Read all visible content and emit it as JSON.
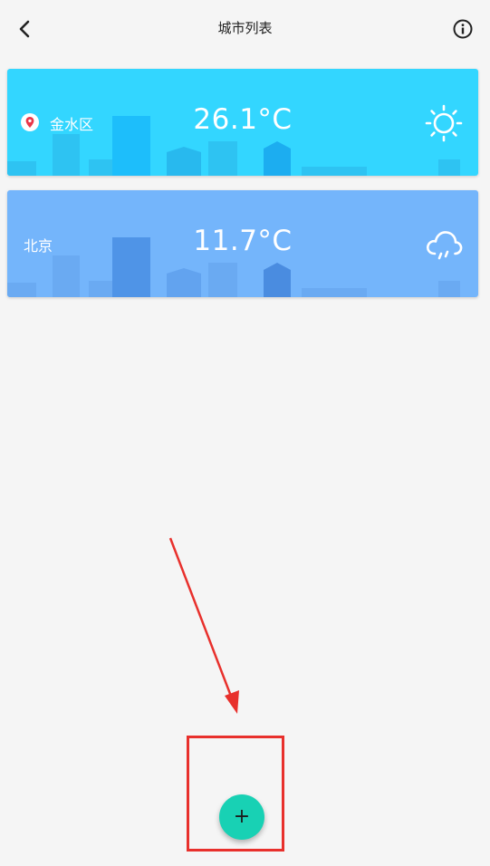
{
  "header": {
    "title": "城市列表",
    "back_icon": "chevron-left-icon",
    "info_icon": "info-icon"
  },
  "cities": [
    {
      "name": "金水区",
      "temperature": "26.1°C",
      "weather_icon": "sun-icon",
      "is_current_location": true,
      "location_icon": "location-pin-icon",
      "card_color": "#33d6ff"
    },
    {
      "name": "北京",
      "temperature": "11.7°C",
      "weather_icon": "cloud-rain-icon",
      "is_current_location": false,
      "card_color": "#74b5fb"
    }
  ],
  "fab": {
    "label": "+",
    "icon": "plus-icon",
    "color": "#18d1b4"
  },
  "annotation_color": "#e8302c"
}
